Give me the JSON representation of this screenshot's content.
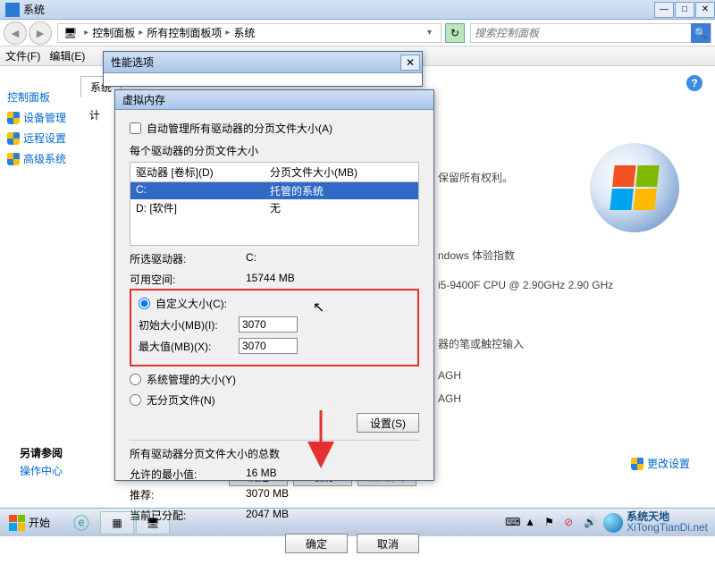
{
  "main": {
    "title": "系统"
  },
  "breadcrumb": {
    "a": "控制面板",
    "b": "所有控制面板项",
    "c": "系统"
  },
  "search": {
    "placeholder": "搜索控制面板"
  },
  "menubar": {
    "file": "文件(F)",
    "edit": "编辑(E)"
  },
  "sidebar": {
    "link0": "控制面板",
    "link1": "设备管理",
    "link2": "远程设置",
    "link3": "高级系统"
  },
  "sys_tabs": {
    "tab0": "系统",
    "tab1": "计"
  },
  "right": {
    "rights": "保留所有权利。",
    "wei": "ndows 体验指数",
    "cpu": "i5-9400F CPU @ 2.90GHz   2.90 GHz",
    "pen": "器的笔或触控输入",
    "agh1": "AGH",
    "agh2": "AGH"
  },
  "links": {
    "see_also": "另请参阅",
    "action_center": "操作中心",
    "change_settings": "更改设置"
  },
  "perf": {
    "title": "性能选项"
  },
  "vm": {
    "title": "虚拟内存",
    "auto_manage": "自动管理所有驱动器的分页文件大小(A)",
    "group_label": "每个驱动器的分页文件大小",
    "col_drive": "驱动器 [卷标](D)",
    "col_size": "分页文件大小(MB)",
    "drives": {
      "c_label": "C:",
      "c_size": "托管的系统",
      "d_label": "D:    [软件]",
      "d_size": "无"
    },
    "selected_drive_label": "所选驱动器:",
    "selected_drive_value": "C:",
    "available_label": "可用空间:",
    "available_value": "15744 MB",
    "custom": "自定义大小(C):",
    "initial": "初始大小(MB)(I):",
    "initial_val": "3070",
    "max": "最大值(MB)(X):",
    "max_val": "3070",
    "system_managed": "系统管理的大小(Y)",
    "no_paging": "无分页文件(N)",
    "set_btn": "设置(S)",
    "totals_title": "所有驱动器分页文件大小的总数",
    "min_allowed_k": "允许的最小值:",
    "min_allowed_v": "16 MB",
    "recommended_k": "推荐:",
    "recommended_v": "3070 MB",
    "allocated_k": "当前已分配:",
    "allocated_v": "2047 MB",
    "ok": "确定",
    "cancel": "取消"
  },
  "sys_btns": {
    "ok": "确定",
    "cancel": "取消",
    "apply": "应用(A)"
  },
  "taskbar": {
    "start": "开始"
  },
  "watermark": {
    "l1": "系统天地",
    "l2": "XiTongTianDi.net"
  }
}
